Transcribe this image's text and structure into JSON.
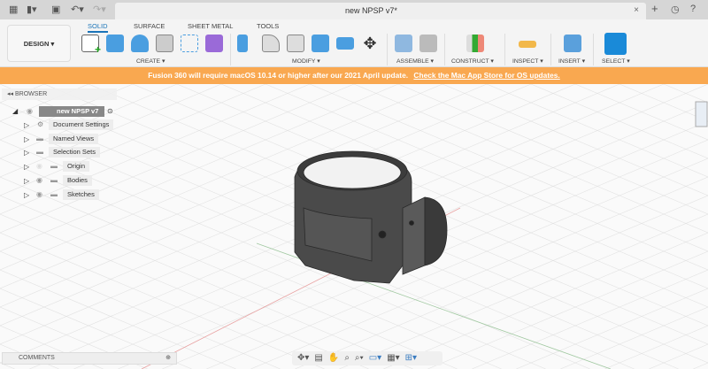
{
  "titlebar": {
    "document_title": "new NPSP v7*",
    "close": "×",
    "icons": [
      "grid-icon",
      "file-icon",
      "save-icon",
      "undo-icon",
      "redo-icon",
      "new-tab-icon",
      "clock-icon",
      "help-icon"
    ]
  },
  "toolbar": {
    "workspace": "DESIGN ▾",
    "tabs": [
      "SOLID",
      "SURFACE",
      "SHEET METAL",
      "TOOLS"
    ],
    "groups": [
      "CREATE ▾",
      "MODIFY ▾",
      "ASSEMBLE ▾",
      "CONSTRUCT ▾",
      "INSPECT ▾",
      "INSERT ▾",
      "SELECT ▾"
    ]
  },
  "banner": {
    "text": "Fusion 360 will require macOS 10.14 or higher after our 2021 April update.",
    "link": "Check the Mac App Store for OS updates."
  },
  "browser": {
    "title": "BROWSER",
    "root": "new NPSP v7",
    "items": [
      "Document Settings",
      "Named Views",
      "Selection Sets",
      "Origin",
      "Bodies",
      "Sketches"
    ]
  },
  "comments": {
    "title": "COMMENTS"
  },
  "colors": {
    "accent": "#1b74b8",
    "banner": "#f9a850",
    "part": "#4a4a4a"
  }
}
